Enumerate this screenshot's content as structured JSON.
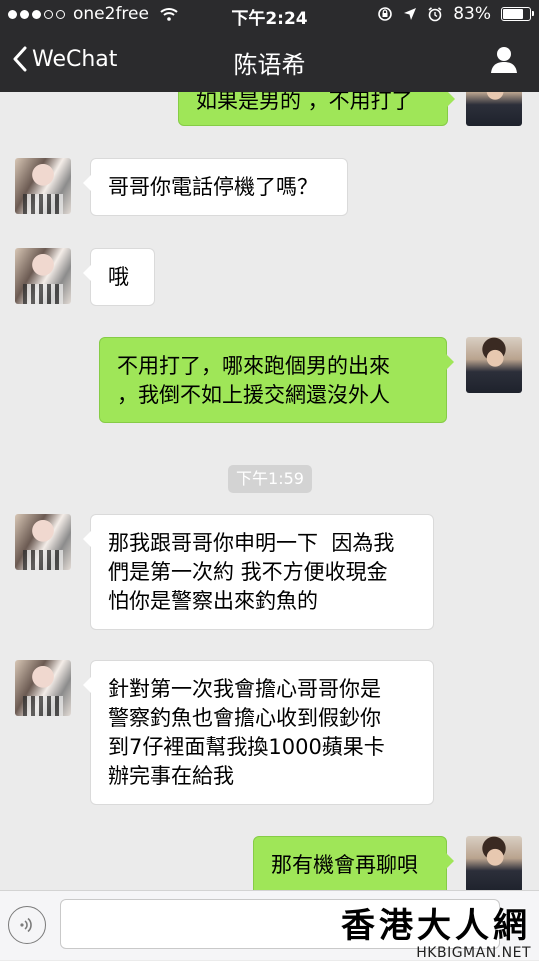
{
  "status_bar": {
    "carrier": "one2free",
    "time": "下午2:24",
    "battery": "83%",
    "battery_level": 0.83
  },
  "nav": {
    "back_label": "WeChat",
    "title": "陈语希",
    "profile_icon": "person-icon"
  },
  "messages": [
    {
      "from": "me",
      "text": "如果是男的 ，不用打了"
    },
    {
      "from": "her",
      "text": "哥哥你電話停機了嗎？"
    },
    {
      "from": "her",
      "text": "哦"
    },
    {
      "from": "me",
      "lines": [
        "不用打了，哪來跑個男的出來",
        "，我倒不如上援交網還沒外人"
      ]
    },
    {
      "from": "her",
      "lines": [
        "那我跟哥哥你申明一下  因為我",
        "們是第一次約 我不方便收現金",
        "怕你是警察出來釣魚的"
      ]
    },
    {
      "from": "her",
      "lines": [
        "針對第一次我會擔心哥哥你是",
        "警察釣魚也會擔心收到假鈔你",
        "到7仔裡面幫我換1000蘋果卡",
        "辦完事在給我"
      ]
    },
    {
      "from": "me",
      "text": "那有機會再聊唄"
    }
  ],
  "timestamp": "下午1:59",
  "input_bar": {
    "voice_icon": "voice-icon",
    "placeholder": ""
  },
  "watermark": {
    "text_cn": "香港大人網",
    "text_en": "HKBIGMAN.NET"
  },
  "colors": {
    "topbar": "#2b2b2d",
    "background": "#ebebeb",
    "outgoing_bubble": "#9fe658",
    "incoming_bubble": "#ffffff"
  }
}
